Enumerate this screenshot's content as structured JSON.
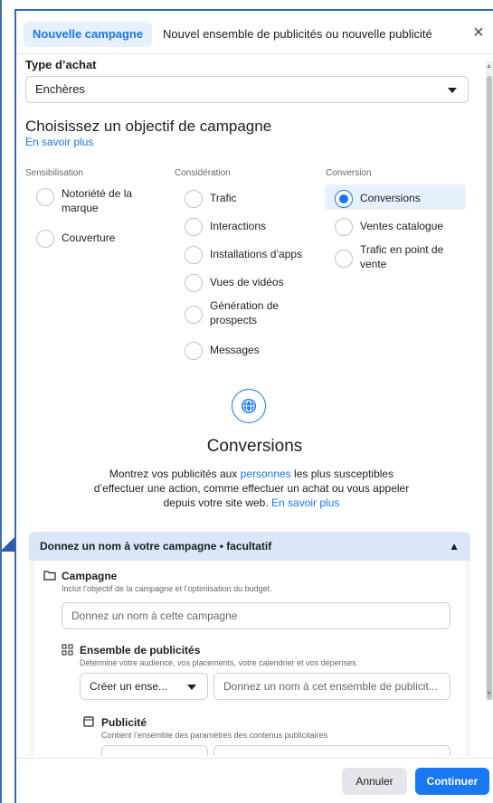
{
  "tabs": {
    "active": "Nouvelle campagne",
    "inactive": "Nouvel ensemble de publicités ou nouvelle publicité",
    "close": "×"
  },
  "purchase": {
    "label": "Type d’achat",
    "value": "Enchères"
  },
  "objective": {
    "title": "Choisissez un objectif de campagne",
    "learn_more": "En savoir plus",
    "columns": [
      {
        "heading": "Sensibilisation",
        "options": [
          "Notoriété de la marque",
          "Couverture"
        ]
      },
      {
        "heading": "Considération",
        "options": [
          "Trafic",
          "Interactions",
          "Installations d’apps",
          "Vues de vidéos",
          "Génération de prospects",
          "Messages"
        ]
      },
      {
        "heading": "Conversion",
        "options": [
          "Conversions",
          "Ventes catalogue",
          "Trafic en point de vente"
        ]
      }
    ],
    "selected": "Conversions"
  },
  "detail": {
    "title": "Conversions",
    "desc_1": "Montrez vos publicités aux ",
    "desc_link": "personnes",
    "desc_2": " les plus susceptibles d’effectuer une action, comme effectuer un achat ou vous appeler depuis votre site web. ",
    "desc_learn": "En savoir plus"
  },
  "naming": {
    "header": "Donnez un nom à votre campagne • facultatif",
    "campaign": {
      "title": "Campagne",
      "subtitle": "Inclut l’objectif de la campagne et l’optimisation du budget.",
      "placeholder": "Donnez un nom à cette campagne"
    },
    "adset": {
      "title": "Ensemble de publicités",
      "subtitle": "Détermine votre audience, vos placements, votre calendrier et vos dépenses.",
      "select": "Créer un ense...",
      "placeholder": "Donnez un nom à cet ensemble de publicit..."
    },
    "ad": {
      "title": "Publicité",
      "subtitle": "Contient l’ensemble des paramètres des contenus publicitaires"
    }
  },
  "footer": {
    "cancel": "Annuler",
    "continue": "Continuer"
  },
  "colors": {
    "accent": "#1877f2",
    "selected_bg": "#e7f0fd",
    "panel_header": "#dbe7f9"
  }
}
